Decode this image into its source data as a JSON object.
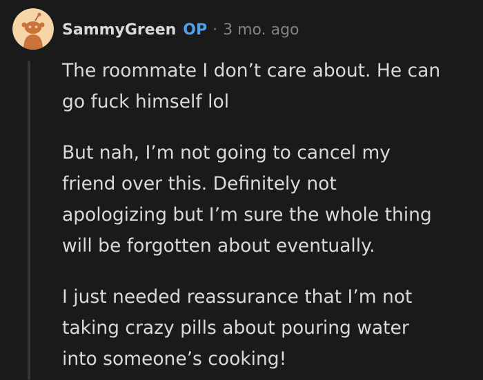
{
  "comment": {
    "author": "SammyGreen",
    "op_badge": "OP",
    "separator": "·",
    "timestamp": "3 mo. ago",
    "paragraphs": [
      [
        "The roommate I don’t care about. He can",
        "go fuck himself lol"
      ],
      [
        "But nah, I’m not going to cancel my",
        "friend over this. Definitely not",
        "apologizing but I’m sure the whole thing",
        "will be forgotten about eventually."
      ],
      [
        "I just needed reassurance that I’m not",
        "taking crazy pills about pouring water",
        "into someone’s cooking!"
      ]
    ]
  },
  "colors": {
    "background": "#1a1a1b",
    "text": "#d7dadc",
    "op_accent": "#4fa0e8",
    "meta": "#818384",
    "avatar_bg": "#f6d6a8",
    "avatar_body": "#c9733a"
  },
  "icons": {
    "avatar": "snoo-avatar-icon"
  }
}
